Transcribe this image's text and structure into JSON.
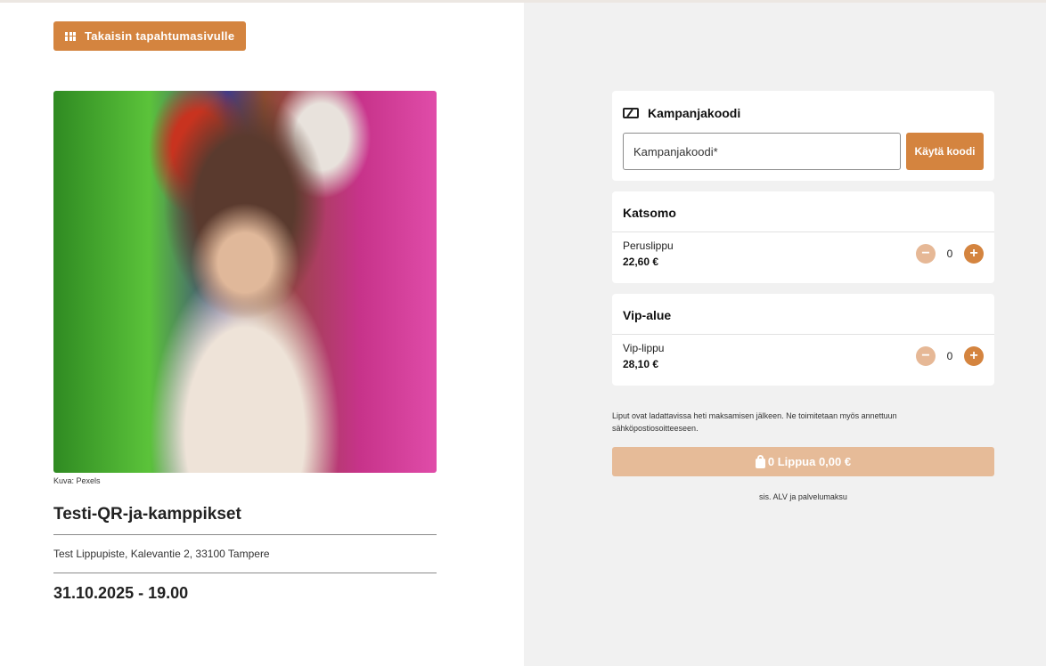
{
  "colors": {
    "accent": "#d4843f",
    "accent_light": "#e6b896",
    "checkout_disabled": "#e6bb98",
    "right_panel_bg": "#f1f1f1"
  },
  "left": {
    "back_button": {
      "label": "Takaisin tapahtumasivulle",
      "icon": "grid-icon"
    },
    "photo_credit": "Kuva: Pexels",
    "event": {
      "title": "Testi-QR-ja-kamppikset",
      "venue": "Test Lippupiste, Kalevantie 2, 33100 Tampere",
      "datetime": "31.10.2025 - 19.00"
    }
  },
  "promo": {
    "icon": "ticket-icon",
    "title": "Kampanjakoodi",
    "input_placeholder": "Kampanjakoodi*",
    "input_value": "",
    "apply_label": "Käytä koodi"
  },
  "categories": [
    {
      "title": "Katsomo",
      "tickets": [
        {
          "name": "Peruslippu",
          "price": "22,60 €",
          "quantity": "0",
          "minus": "−",
          "plus": "+"
        }
      ]
    },
    {
      "title": "Vip-alue",
      "tickets": [
        {
          "name": "Vip-lippu",
          "price": "28,10 €",
          "quantity": "0",
          "minus": "−",
          "plus": "+"
        }
      ]
    }
  ],
  "info_text": "Liput ovat ladattavissa heti maksamisen jälkeen. Ne toimitetaan myös annettuun sähköpostiosoitteeseen.",
  "checkout": {
    "icon": "shopping-bag-icon",
    "label": "0 Lippua 0,00 €"
  },
  "vat_text": "sis. ALV ja palvelumaksu"
}
